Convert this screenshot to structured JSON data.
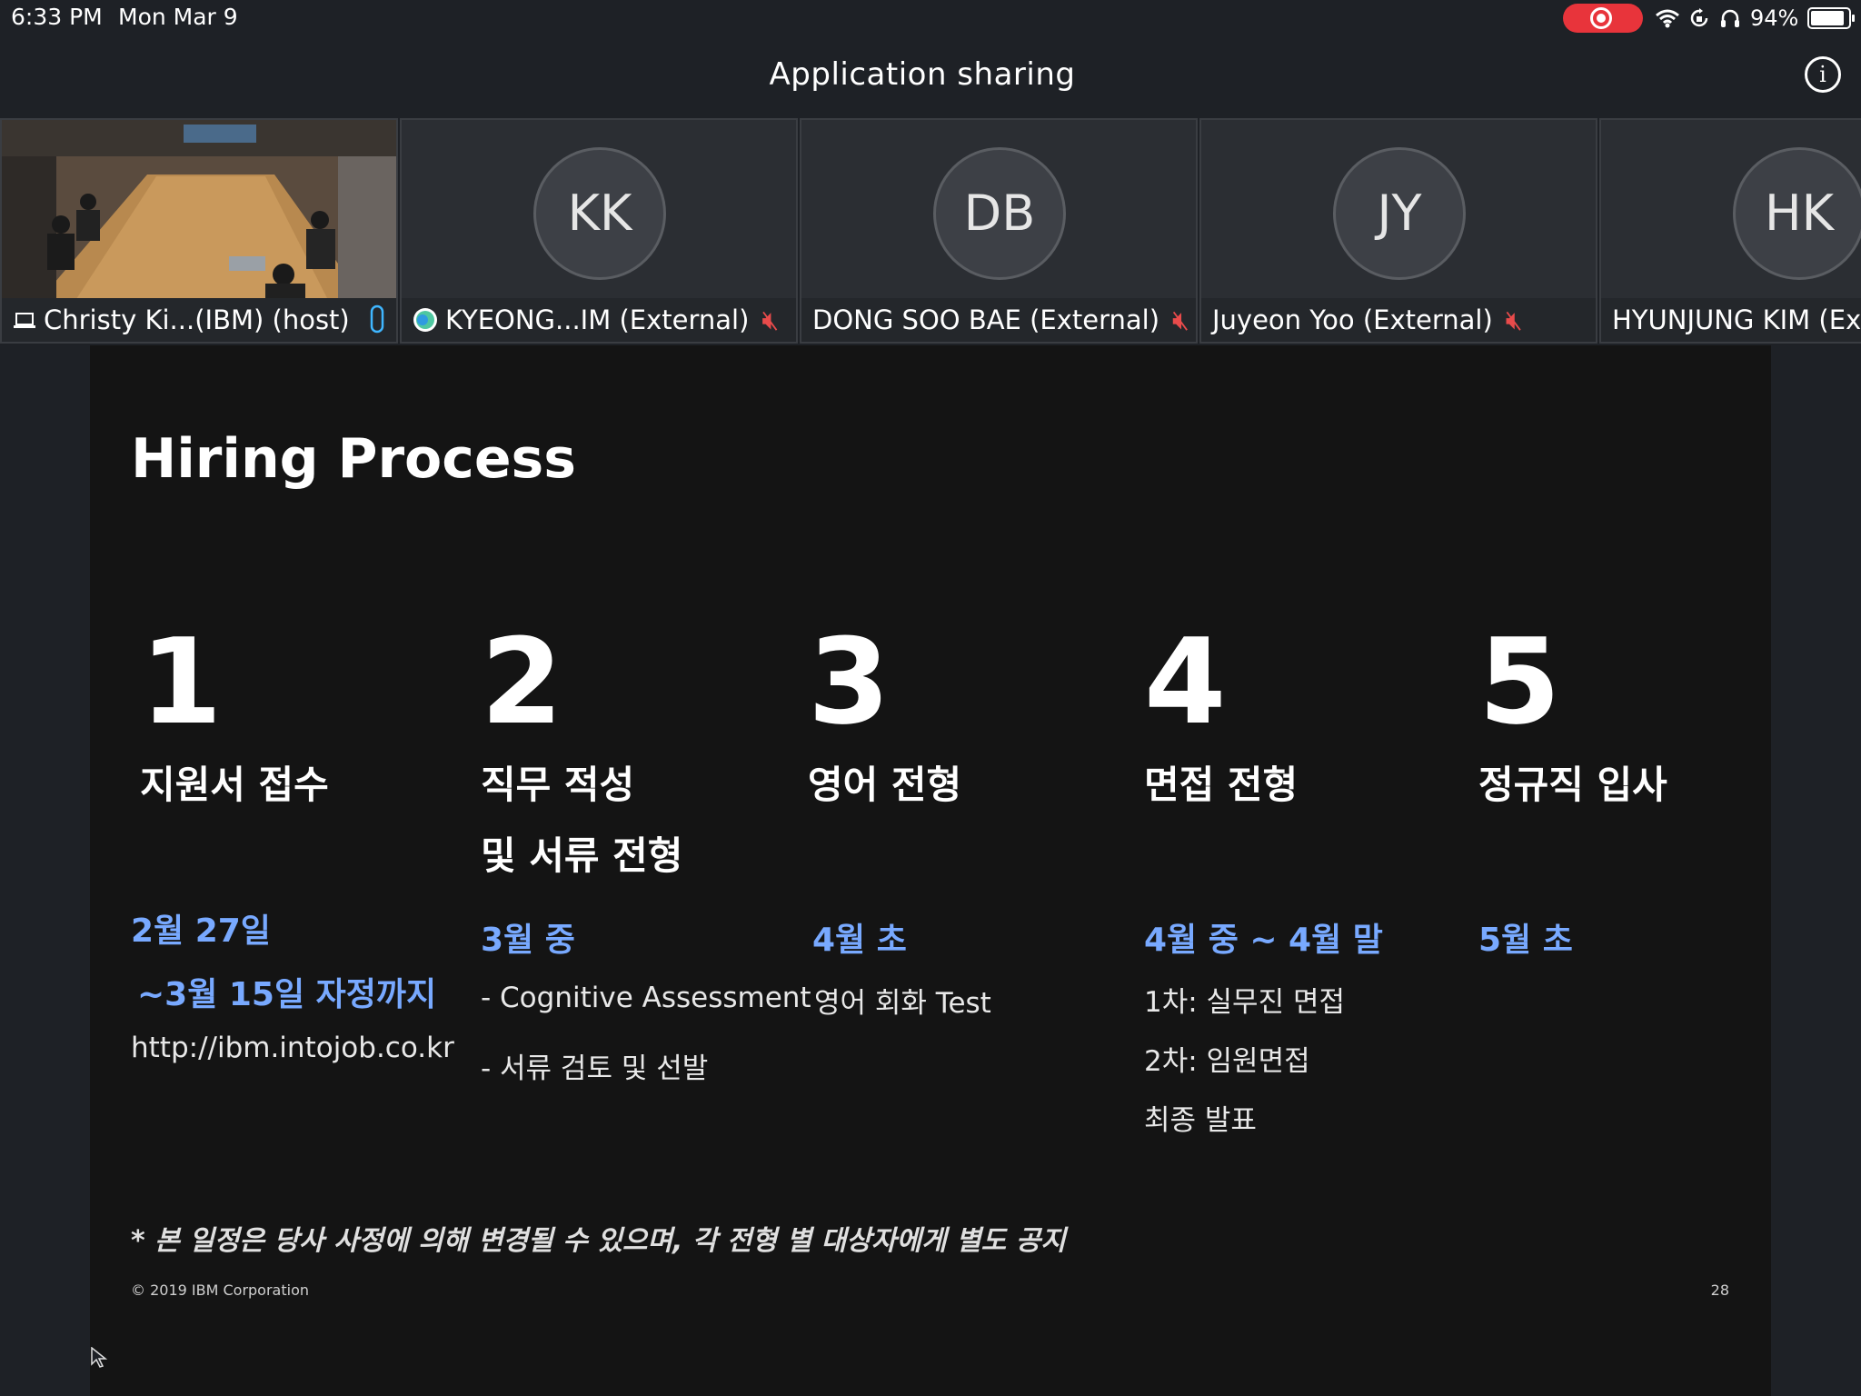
{
  "status_bar": {
    "time": "6:33 PM",
    "date": "Mon Mar 9",
    "battery": "94%"
  },
  "header": {
    "title": "Application sharing",
    "info_icon": "i"
  },
  "participants": [
    {
      "name": "Christy Ki...(IBM) (host)",
      "initials": "",
      "has_video": true,
      "mic": "on"
    },
    {
      "name": "KYEONG...IM (External)",
      "initials": "KK",
      "mic": "muted"
    },
    {
      "name": "DONG SOO BAE (External)",
      "initials": "DB",
      "mic": "muted"
    },
    {
      "name": "Juyeon Yoo (External)",
      "initials": "JY",
      "mic": "muted"
    },
    {
      "name": "HYUNJUNG KIM (Ex",
      "initials": "HK",
      "mic": "unknown"
    }
  ],
  "slide": {
    "title": "Hiring Process",
    "steps": [
      {
        "num": "1",
        "name_lines": [
          "지원서 접수"
        ],
        "dates": [
          "2월 27일",
          "~3월 15일 자정까지"
        ],
        "details": [
          "http://ibm.intojob.co.kr"
        ]
      },
      {
        "num": "2",
        "name_lines": [
          "직무 적성",
          "및 서류 전형"
        ],
        "dates": [
          "3월 중"
        ],
        "details": [
          "- Cognitive Assessment",
          "- 서류 검토 및 선발"
        ]
      },
      {
        "num": "3",
        "name_lines": [
          "영어 전형"
        ],
        "dates": [
          "4월 초"
        ],
        "details": [
          "영어 회화 Test"
        ]
      },
      {
        "num": "4",
        "name_lines": [
          "면접 전형"
        ],
        "dates": [
          "4월 중 ~ 4월 말"
        ],
        "details": [
          "1차: 실무진 면접",
          "2차: 임원면접",
          "최종 발표"
        ]
      },
      {
        "num": "5",
        "name_lines": [
          "정규직 입사"
        ],
        "dates": [
          "5월 초"
        ],
        "details": []
      }
    ],
    "note": "* 본 일정은 당사 사정에 의해 변경될 수 있으며, 각 전형 별 대상자에게 별도 공지",
    "copyright": "© 2019 IBM Corporation",
    "page_number": "28"
  },
  "colors": {
    "accent_blue": "#78a9ff",
    "record_red": "#e8343b",
    "mute_red": "#e94b4b",
    "mic_active": "#3fb6ff"
  }
}
